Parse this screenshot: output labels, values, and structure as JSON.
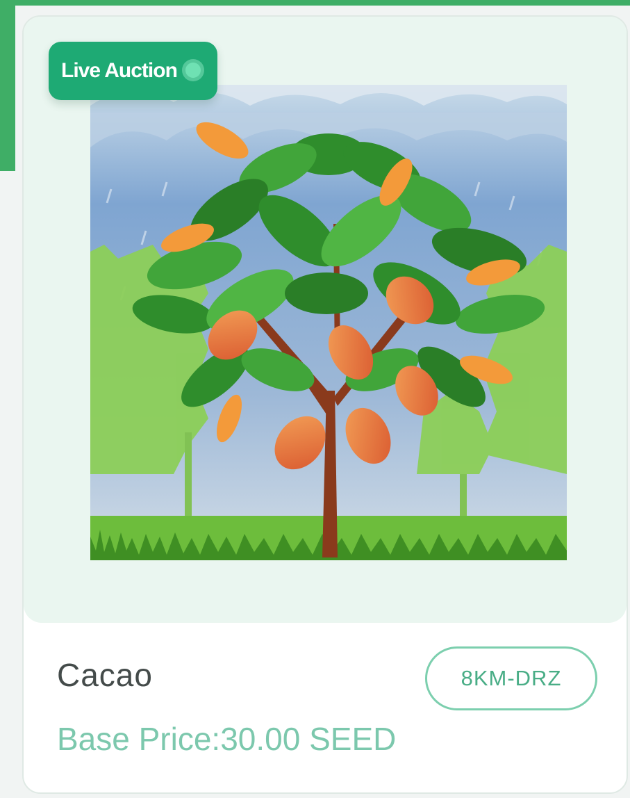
{
  "card": {
    "badge_label": "Live Auction",
    "name": "Cacao",
    "code": "8KM-DRZ",
    "price": "Base Price:30.00 SEED",
    "image_icon": "cacao-tree-illustration"
  },
  "colors": {
    "accent_green": "#3fae66",
    "badge_green": "#1eaa74",
    "pill_border": "#7ccfae",
    "price_text": "#7cc8ad",
    "name_text": "#444b4a",
    "media_background": "#eaf6f0"
  }
}
